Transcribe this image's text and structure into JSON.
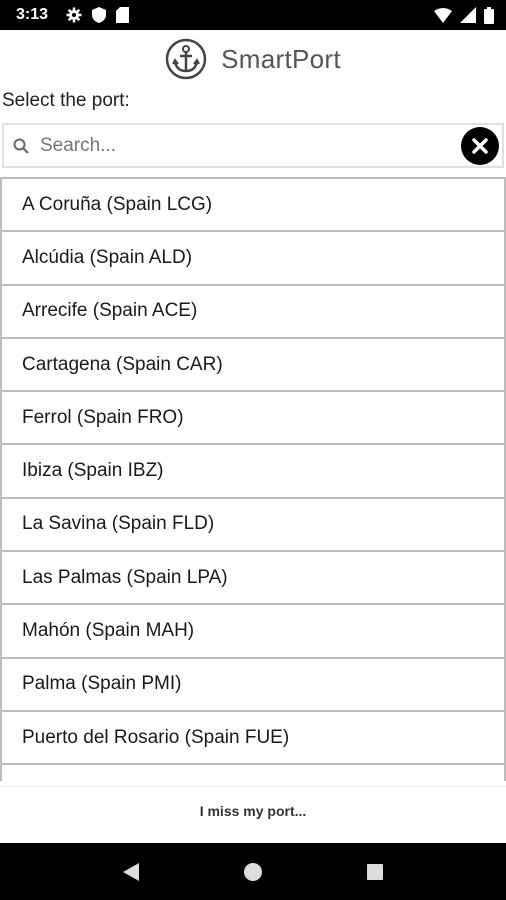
{
  "status_bar": {
    "time": "3:13",
    "left_icons": [
      "gear-icon",
      "shield-icon",
      "sd-card-icon"
    ],
    "right_icons": [
      "wifi-icon",
      "signal-icon",
      "battery-icon"
    ]
  },
  "header": {
    "title": "SmartPort",
    "logo_icon": "anchor-icon"
  },
  "prompt": "Select the port:",
  "search": {
    "placeholder": "Search...",
    "value": ""
  },
  "ports": [
    "A Coruña (Spain LCG)",
    "Alcúdia (Spain ALD)",
    "Arrecife (Spain ACE)",
    "Cartagena (Spain CAR)",
    "Ferrol (Spain FRO)",
    "Ibiza (Spain IBZ)",
    "La Savina (Spain FLD)",
    "Las Palmas (Spain LPA)",
    "Mahón (Spain MAH)",
    "Palma (Spain PMI)",
    "Puerto del Rosario (Spain FUE)"
  ],
  "miss_port_label": "I miss my port...",
  "colors": {
    "bars": "#000000",
    "list_border": "#bdbdbd",
    "title_text": "#555555"
  }
}
